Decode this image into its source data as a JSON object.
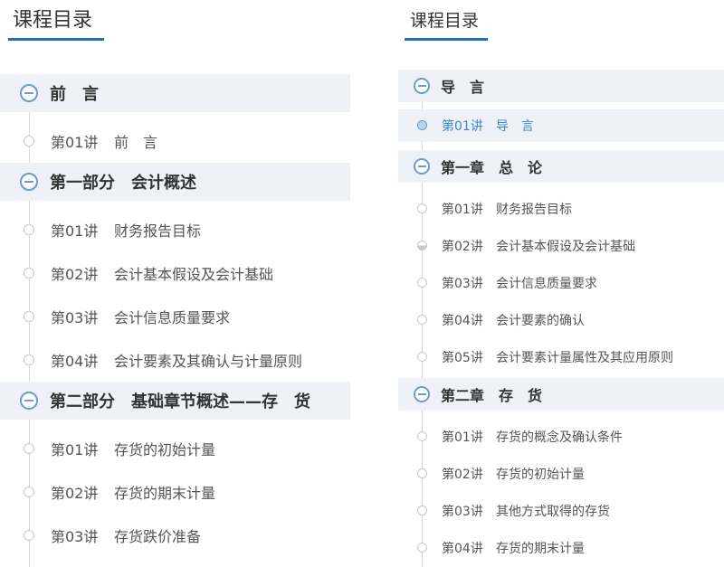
{
  "left": {
    "title": "课程目录",
    "sections": [
      {
        "title": "前　言",
        "items": [
          {
            "num": "第01讲",
            "title": "前　言"
          }
        ]
      },
      {
        "title": "第一部分　会计概述",
        "items": [
          {
            "num": "第01讲",
            "title": "财务报告目标"
          },
          {
            "num": "第02讲",
            "title": "会计基本假设及会计基础"
          },
          {
            "num": "第03讲",
            "title": "会计信息质量要求"
          },
          {
            "num": "第04讲",
            "title": "会计要素及其确认与计量原则"
          }
        ]
      },
      {
        "title": "第二部分　基础章节概述——存　货",
        "items": [
          {
            "num": "第01讲",
            "title": "存货的初始计量"
          },
          {
            "num": "第02讲",
            "title": "存货的期末计量"
          },
          {
            "num": "第03讲",
            "title": "存货跌价准备"
          }
        ]
      }
    ]
  },
  "right": {
    "title": "课程目录",
    "sections": [
      {
        "title": "导　言",
        "items": [
          {
            "num": "第01讲",
            "title": "导　言",
            "active": true
          }
        ]
      },
      {
        "title": "第一章　总　论",
        "items": [
          {
            "num": "第01讲",
            "title": "财务报告目标"
          },
          {
            "num": "第02讲",
            "title": "会计基本假设及会计基础",
            "partial": true
          },
          {
            "num": "第03讲",
            "title": "会计信息质量要求"
          },
          {
            "num": "第04讲",
            "title": "会计要素的确认"
          },
          {
            "num": "第05讲",
            "title": "会计要素计量属性及其应用原则"
          }
        ]
      },
      {
        "title": "第二章　存　货",
        "items": [
          {
            "num": "第01讲",
            "title": "存货的概念及确认条件"
          },
          {
            "num": "第02讲",
            "title": "存货的初始计量"
          },
          {
            "num": "第03讲",
            "title": "其他方式取得的存货"
          },
          {
            "num": "第04讲",
            "title": "存货的期末计量"
          }
        ]
      }
    ]
  }
}
